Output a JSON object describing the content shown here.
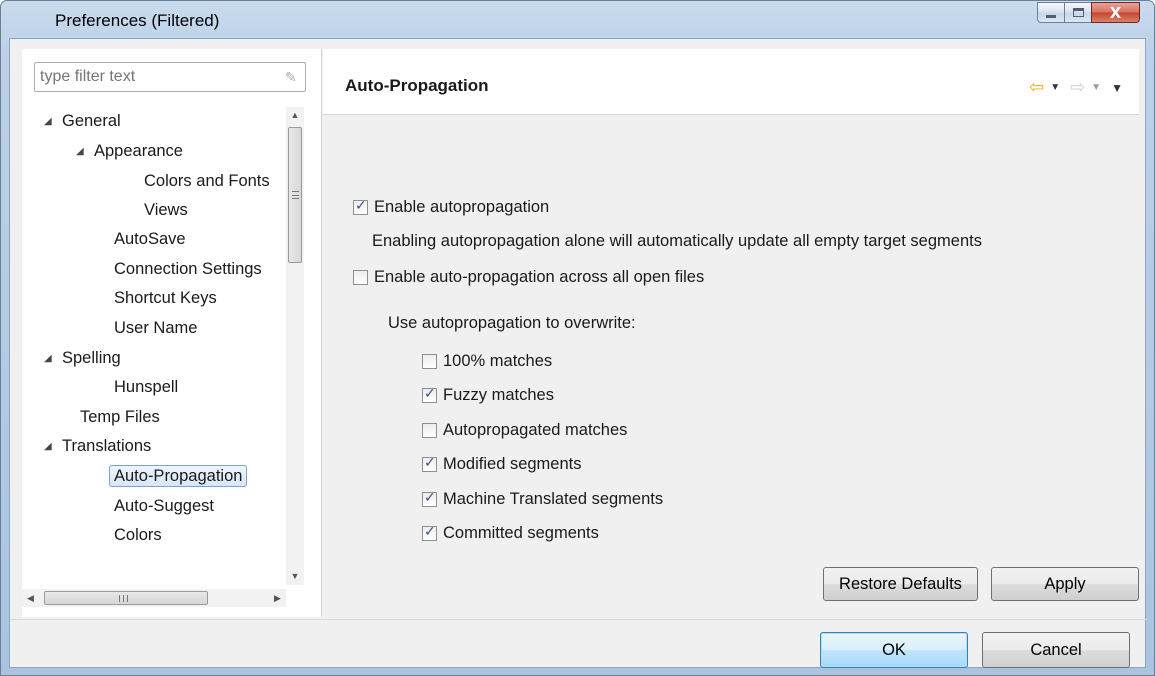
{
  "window": {
    "title": "Preferences (Filtered)",
    "controls": {
      "minimize": "minimize",
      "maximize": "maximize",
      "close": "X"
    }
  },
  "filter": {
    "placeholder": "type filter text"
  },
  "tree": {
    "items": [
      {
        "label": "General",
        "expanded": true
      },
      {
        "label": "Appearance",
        "expanded": true
      },
      {
        "label": "Colors and Fonts"
      },
      {
        "label": "Views"
      },
      {
        "label": "AutoSave"
      },
      {
        "label": "Connection Settings"
      },
      {
        "label": "Shortcut Keys"
      },
      {
        "label": "User Name"
      },
      {
        "label": "Spelling",
        "expanded": true
      },
      {
        "label": "Hunspell"
      },
      {
        "label": "Temp Files"
      },
      {
        "label": "Translations",
        "expanded": true
      },
      {
        "label": "Auto-Propagation",
        "selected": true
      },
      {
        "label": "Auto-Suggest"
      },
      {
        "label": "Colors"
      }
    ]
  },
  "page": {
    "title": "Auto-Propagation",
    "enable_autopropagation": {
      "label": "Enable autopropagation",
      "checked": true
    },
    "description": "Enabling autopropagation alone will automatically update all empty target segments",
    "enable_across_files": {
      "label": "Enable auto-propagation across all open files",
      "checked": false
    },
    "overwrite_label": "Use autopropagation to overwrite:",
    "overwrite_options": [
      {
        "label": "100% matches",
        "checked": false
      },
      {
        "label": "Fuzzy matches",
        "checked": true
      },
      {
        "label": "Autopropagated matches",
        "checked": false
      },
      {
        "label": "Modified segments",
        "checked": true
      },
      {
        "label": "Machine Translated segments",
        "checked": true
      },
      {
        "label": "Committed segments",
        "checked": true
      }
    ],
    "restore_defaults_label": "Restore Defaults",
    "apply_label": "Apply"
  },
  "dialog": {
    "ok_label": "OK",
    "cancel_label": "Cancel"
  },
  "icons": {
    "back": "back-arrow-icon",
    "forward": "forward-arrow-icon",
    "view_menu": "view-menu-icon",
    "clear_filter": "clear-filter-icon"
  },
  "colors": {
    "back_arrow": "#e8b21f",
    "checkmark": "#3c4f8c",
    "selection_border": "#7da2ce",
    "default_button_border": "#3c7fb1"
  }
}
